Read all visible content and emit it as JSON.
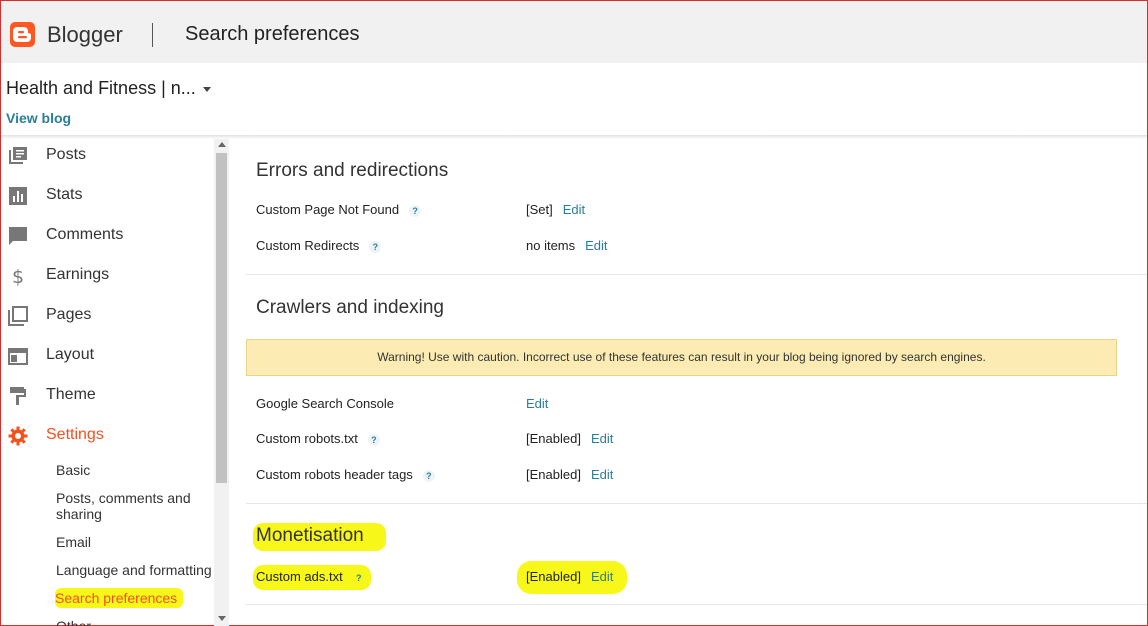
{
  "app": {
    "brand": "Blogger",
    "page_title": "Search preferences",
    "accent_color": "#ff5722"
  },
  "blog": {
    "name": "Health and Fitness | n...",
    "view_blog_label": "View blog"
  },
  "sidebar": {
    "items": [
      {
        "label": "Posts",
        "icon": "posts-icon"
      },
      {
        "label": "Stats",
        "icon": "stats-icon"
      },
      {
        "label": "Comments",
        "icon": "comments-icon"
      },
      {
        "label": "Earnings",
        "icon": "dollar-icon"
      },
      {
        "label": "Pages",
        "icon": "pages-icon"
      },
      {
        "label": "Layout",
        "icon": "layout-icon"
      },
      {
        "label": "Theme",
        "icon": "paint-roller-icon"
      },
      {
        "label": "Settings",
        "icon": "gear-icon",
        "active": true
      }
    ],
    "settings_sub": [
      "Basic",
      "Posts, comments and sharing",
      "Email",
      "Language and formatting",
      "Search preferences",
      "Other"
    ]
  },
  "main": {
    "errors": {
      "title": "Errors and redirections",
      "rows": [
        {
          "label": "Custom Page Not Found",
          "value": "[Set]",
          "edit": "Edit"
        },
        {
          "label": "Custom Redirects",
          "value": "no items",
          "edit": "Edit"
        }
      ]
    },
    "crawlers": {
      "title": "Crawlers and indexing",
      "warning": "Warning! Use with caution. Incorrect use of these features can result in your blog being ignored by search engines.",
      "rows": [
        {
          "label": "Google Search Console",
          "value": "",
          "edit": "Edit"
        },
        {
          "label": "Custom robots.txt",
          "value": "[Enabled]",
          "edit": "Edit"
        },
        {
          "label": "Custom robots header tags",
          "value": "[Enabled]",
          "edit": "Edit"
        }
      ]
    },
    "monetisation": {
      "title": "Monetisation",
      "rows": [
        {
          "label": "Custom ads.txt",
          "value": "[Enabled]",
          "edit": "Edit"
        }
      ]
    },
    "help_glyph": "?"
  }
}
